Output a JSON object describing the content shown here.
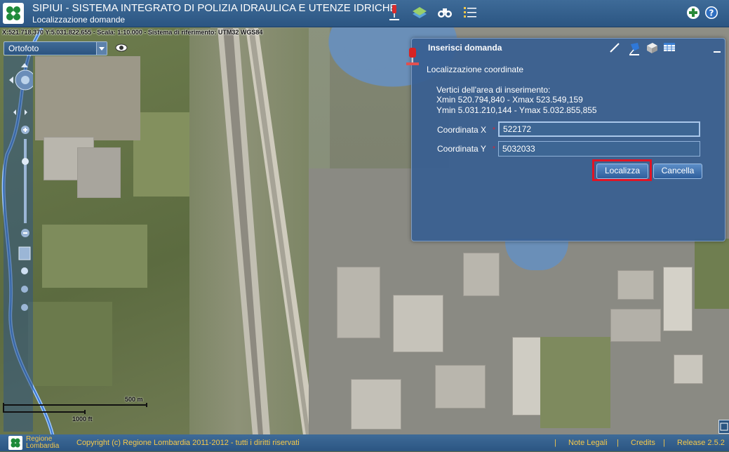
{
  "header": {
    "title": "SIPIUI - SISTEMA INTEGRATO DI POLIZIA IDRAULICA E UTENZE IDRICHE",
    "subtitle": "Localizzazione domande",
    "icons": [
      "pin-icon",
      "layers-icon",
      "binoculars-icon",
      "list-icon",
      "add-icon",
      "help-icon"
    ]
  },
  "coordinates": "X:521.718,370 Y:5.031.822,655 - Scala: 1:10.000 - Sistema di riferimento: UTM32 WGS84",
  "base_layer": {
    "selected": "Ortofoto"
  },
  "scale": {
    "metric": "500 m",
    "imperial": "1000 ft"
  },
  "dialog": {
    "title": "Inserisci domanda",
    "section": "Localizzazione coordinate",
    "info_line1": "Vertici dell'area di inserimento:",
    "info_line2": "Xmin 520.794,840 - Xmax 523.549,159",
    "info_line3": "Ymin 5.031.210,144 - Ymax 5.032.855,855",
    "x_label": "Coordinata X",
    "x_value": "522172",
    "y_label": "Coordinata Y",
    "y_value": "5032033",
    "required_mark": "*",
    "localizza_label": "Localizza",
    "cancella_label": "Cancella",
    "tools": [
      "pencil-icon",
      "pin-tool-icon",
      "cube-icon",
      "table-icon"
    ]
  },
  "footer": {
    "org_line1": "Regione",
    "org_line2": "Lombardia",
    "copyright": "Copyright (c) Regione Lombardia 2011-2012 - tutti i diritti riservati",
    "separator": "|",
    "legal": "Note Legali",
    "credits": "Credits",
    "release": "Release 2.5.2"
  },
  "colors": {
    "header_bg": "#2f5b88",
    "dialog_bg": "#385f91",
    "highlight": "#e01424",
    "footer_text": "#f5c84a"
  }
}
